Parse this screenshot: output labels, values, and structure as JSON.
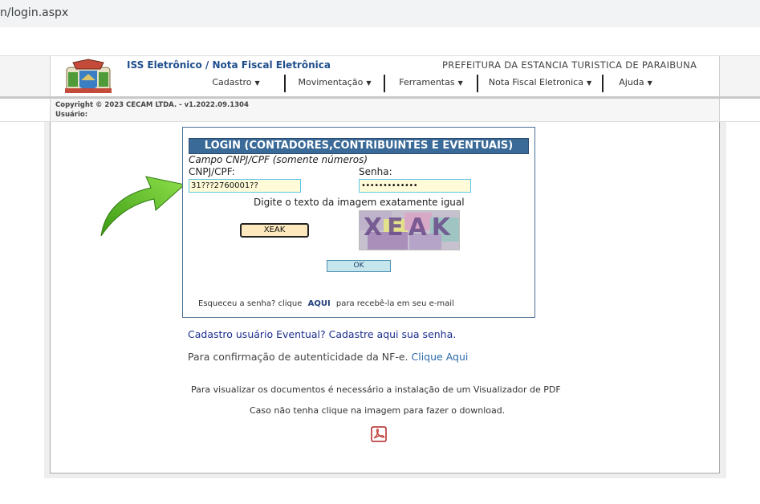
{
  "browser": {
    "url": "n/login.aspx"
  },
  "header": {
    "app_title": "ISS Eletrônico / Nota Fiscal Eletrônica",
    "city": "PREFEITURA DA ESTANCIA TURISTICA DE PARAIBUNA",
    "nav": [
      {
        "label": "Cadastro"
      },
      {
        "label": "Movimentação"
      },
      {
        "label": "Ferramentas"
      },
      {
        "label": "Nota Fiscal Eletronica"
      },
      {
        "label": "Ajuda"
      }
    ]
  },
  "subbar": {
    "copyright": "Copyright © 2023 CECAM LTDA. - v1.2022.09.1304",
    "user_label": "Usuário:"
  },
  "login": {
    "title": "LOGIN (CONTADORES,CONTRIBUINTES E EVENTUAIS)",
    "field_hint": "Campo CNPJ/CPF (somente números)",
    "cnpj_label": "CNPJ/CPF:",
    "cnpj_value": "31???2760001??",
    "senha_label": "Senha:",
    "senha_value": "•••••••••••••",
    "captcha_hint": "Digite o texto da imagem exatamente igual",
    "captcha_value": "XEAK",
    "captcha_image_text": "XEAK",
    "ok_label": "OK",
    "forgot_prefix": "Esqueceu a senha? clique",
    "forgot_link": "AQUI",
    "forgot_suffix": "para recebê-la em seu e-mail"
  },
  "links": {
    "eventual": "Cadastro usuário Eventual? Cadastre aqui sua senha.",
    "confirm_prefix": "Para confirmação de autenticidade da NF-e.",
    "confirm_link": "Clique Aqui"
  },
  "pdf": {
    "note1": "Para visualizar os documentos é necessário a instalação de um Visualizador de PDF",
    "note2": "Caso não tenha clique na imagem para fazer o download."
  },
  "colors": {
    "header_bar": "#3a6a98",
    "title_blue": "#1f4e8c",
    "arrow_green": "#5cbf1e"
  }
}
